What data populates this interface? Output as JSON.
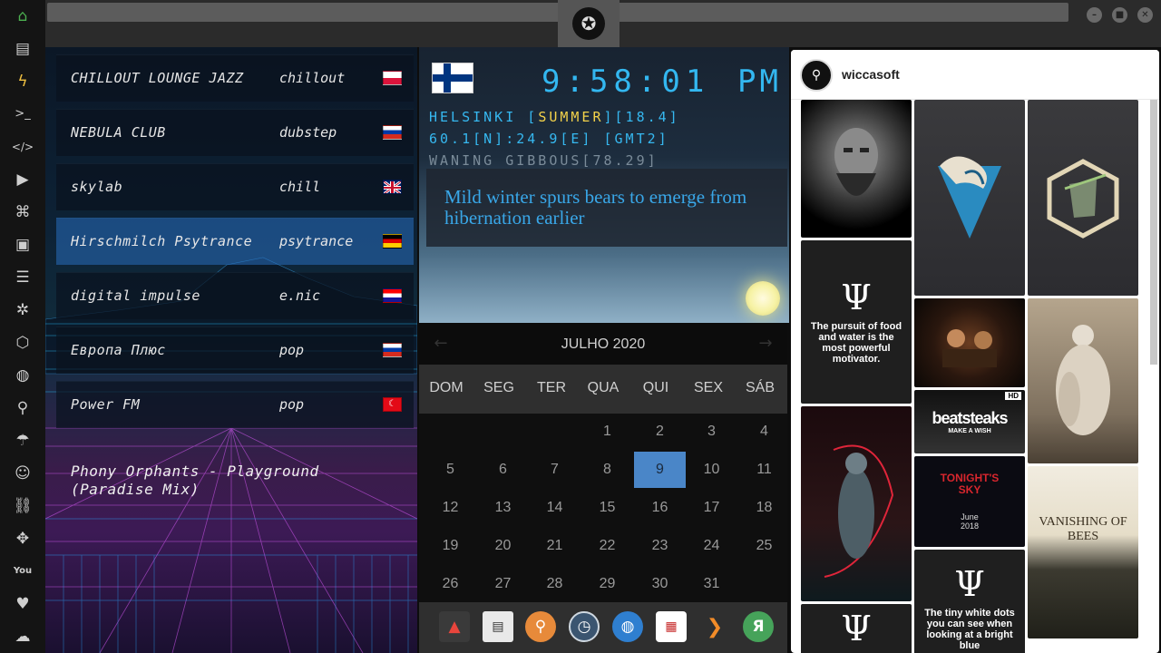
{
  "sidebar": {
    "icons": [
      "home-icon",
      "document-icon",
      "bolt-icon",
      "terminal-icon",
      "code-icon",
      "play-icon",
      "translate-icon",
      "image-icon",
      "news-icon",
      "asterisk-icon",
      "hexagon-icon",
      "globe-icon",
      "search-icon",
      "umbrella-icon",
      "contact-icon",
      "link-icon",
      "fullscreen-icon",
      "youtube-icon",
      "heart-icon",
      "cloud-icon"
    ]
  },
  "radio": {
    "stations": [
      {
        "name": "CHILLOUT LOUNGE JAZZ",
        "genre": "chillout",
        "flag": "PL"
      },
      {
        "name": "NEBULA CLUB",
        "genre": "dubstep",
        "flag": "RU"
      },
      {
        "name": "skylab",
        "genre": "chill",
        "flag": "GB"
      },
      {
        "name": "Hirschmilch Psytrance",
        "genre": "psytrance",
        "flag": "DE"
      },
      {
        "name": "digital impulse",
        "genre": "e.nic",
        "flag": "HR"
      },
      {
        "name": "Европа Плюс",
        "genre": "pop",
        "flag": "RU"
      },
      {
        "name": "Power FM",
        "genre": "pop",
        "flag": "TR"
      }
    ],
    "active_index": 3,
    "now_playing": "Phony Orphants - Playground (Paradise Mix)"
  },
  "clock": {
    "time": "9:58:01",
    "ampm": "PM",
    "line1": "HELSINKI [",
    "season": "SUMMER",
    "line1_end": "][18.4]",
    "line2": "60.1[N]:24.9[E] [GMT2]",
    "line3": "WANING GIBBOUS[78.29]",
    "news": "Mild winter spurs bears to emerge from hibernation earlier"
  },
  "calendar": {
    "title": "JULHO 2020",
    "daynames": [
      "DOM",
      "SEG",
      "TER",
      "QUA",
      "QUI",
      "SEX",
      "SÁB"
    ],
    "rows": [
      [
        "",
        "",
        "",
        "1",
        "2",
        "3",
        "4"
      ],
      [
        "5",
        "6",
        "7",
        "8",
        "9",
        "10",
        "11"
      ],
      [
        "12",
        "13",
        "14",
        "15",
        "16",
        "17",
        "18"
      ],
      [
        "19",
        "20",
        "21",
        "22",
        "23",
        "24",
        "25"
      ],
      [
        "26",
        "27",
        "28",
        "29",
        "30",
        "31",
        ""
      ]
    ],
    "today": "9"
  },
  "dock": {
    "icons": [
      "acrobat-icon",
      "news-reader-icon",
      "search-app-icon",
      "clock-app-icon",
      "browser-icon",
      "calendar-app-icon",
      "arrow-app-icon",
      "yandex-icon"
    ]
  },
  "insta": {
    "username": "wiccasoft",
    "quote1": "The pursuit of food and water is the most powerful motivator.",
    "quote2": "The tiny white dots you can see when looking at a bright blue",
    "beatsteaks": "beatsteaks",
    "beatsteaks_sub": "MAKE A WISH",
    "hd": "HD",
    "tonight": "TONIGHT'S SKY",
    "tonight_sub": "June 2018",
    "vanishing": "VANISHING OF BEES",
    "psi": "Ψ"
  }
}
